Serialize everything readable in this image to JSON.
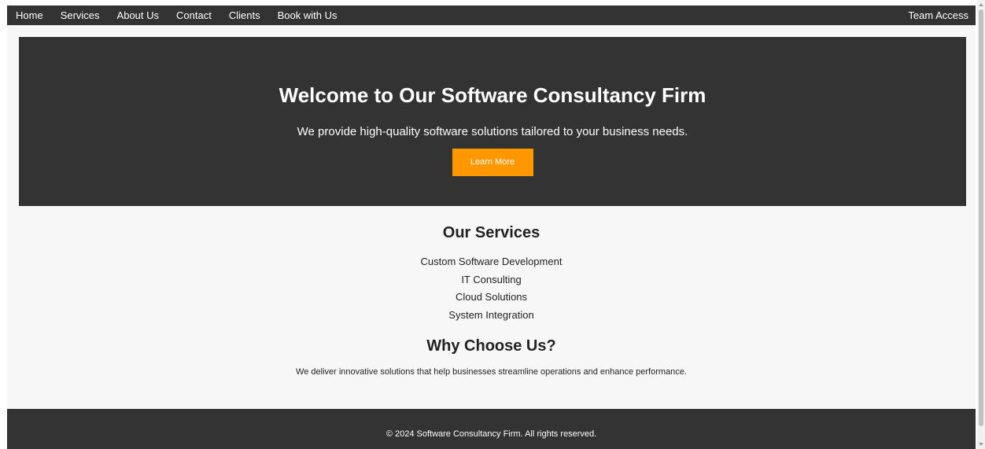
{
  "nav": {
    "items": [
      {
        "label": "Home"
      },
      {
        "label": "Services"
      },
      {
        "label": "About Us"
      },
      {
        "label": "Contact"
      },
      {
        "label": "Clients"
      },
      {
        "label": "Book with Us"
      }
    ],
    "right_label": "Team Access"
  },
  "hero": {
    "title": "Welcome to Our Software Consultancy Firm",
    "subtitle": "We provide high-quality software solutions tailored to your business needs.",
    "button_label": "Learn More"
  },
  "services": {
    "title": "Our Services",
    "items": [
      "Custom Software Development",
      "IT Consulting",
      "Cloud Solutions",
      "System Integration"
    ]
  },
  "why": {
    "title": "Why Choose Us?",
    "text": "We deliver innovative solutions that help businesses streamline operations and enhance performance."
  },
  "footer": {
    "text": "© 2024 Software Consultancy Firm. All rights reserved."
  },
  "colors": {
    "dark": "#333333",
    "accent": "#ff9800",
    "background": "#f7f7f7"
  }
}
